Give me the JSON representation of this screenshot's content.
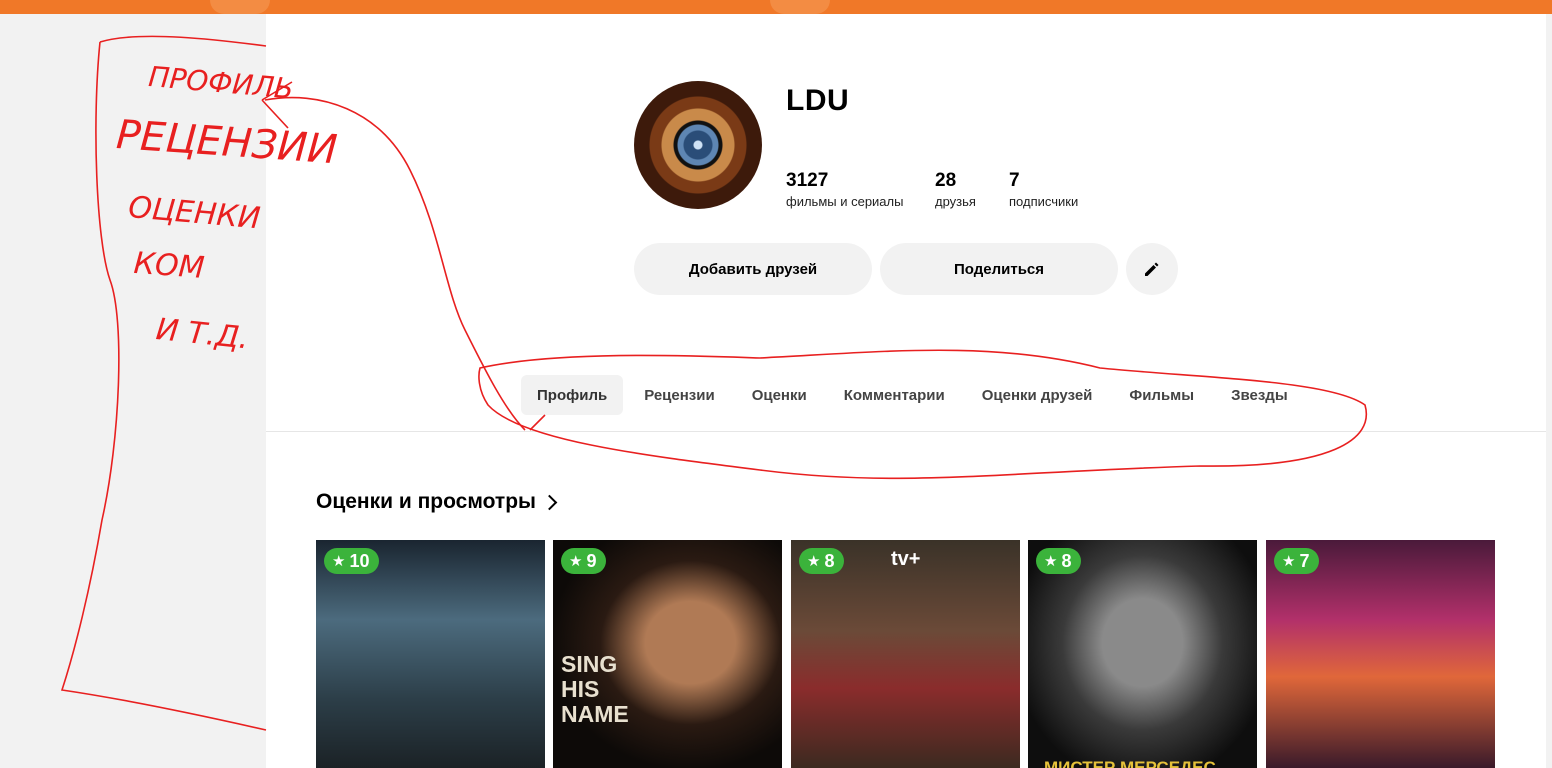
{
  "profile": {
    "username": "LDU",
    "stats": [
      {
        "value": "3127",
        "label": "фильмы и сериалы"
      },
      {
        "value": "28",
        "label": "друзья"
      },
      {
        "value": "7",
        "label": "подписчики"
      }
    ],
    "buttons": {
      "add_friends": "Добавить друзей",
      "share": "Поделиться"
    }
  },
  "tabs": [
    "Профиль",
    "Рецензии",
    "Оценки",
    "Комментарии",
    "Оценки друзей",
    "Фильмы",
    "Звезды"
  ],
  "section": {
    "title": "Оценки и просмотры"
  },
  "posters": [
    {
      "rating": "10",
      "text": ""
    },
    {
      "rating": "9",
      "text": "SING HIS NAME"
    },
    {
      "rating": "8",
      "text": "tv+"
    },
    {
      "rating": "8",
      "text": "МИСТЕР МЕРСЕДЕС"
    },
    {
      "rating": "7",
      "text": ""
    }
  ],
  "annotation": {
    "lines": [
      "ПРОФИЛЬ",
      "РЕЦЕНЗИИ",
      "ОЦЕНКИ",
      "КОМ",
      "И Т.Д."
    ]
  },
  "colors": {
    "accent": "#f07828",
    "badge": "#3bb33b",
    "annotation": "#e82020"
  }
}
